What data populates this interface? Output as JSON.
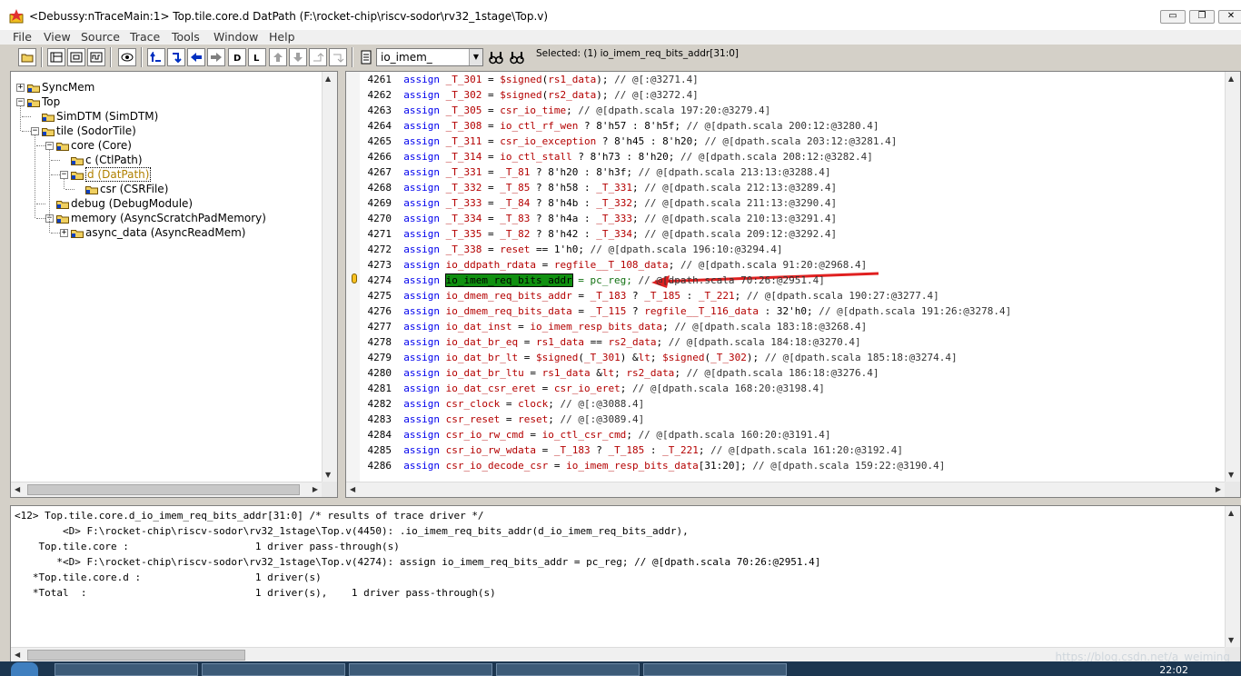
{
  "window": {
    "title": "<Debussy:nTraceMain:1> Top.tile.core.d DatPath (F:\\rocket-chip\\riscv-sodor\\rv32_1stage\\Top.v)",
    "controls": [
      "▭",
      "❐",
      "✕"
    ]
  },
  "menu": [
    "File",
    "View",
    "Source",
    "Trace",
    "Tools",
    "Window",
    "Help"
  ],
  "toolbar": {
    "signal_value": "io_imem_",
    "selected_text": "Selected: (1) io_imem_req_bits_addr[31:0]"
  },
  "hierarchy": [
    {
      "label": "SyncMem",
      "level": 0,
      "toggle": "+"
    },
    {
      "label": "Top",
      "level": 0,
      "toggle": "-"
    },
    {
      "label": "SimDTM (SimDTM)",
      "level": 1,
      "toggle": ""
    },
    {
      "label": "tile (SodorTile)",
      "level": 1,
      "toggle": "-"
    },
    {
      "label": "core (Core)",
      "level": 2,
      "toggle": "-"
    },
    {
      "label": "c (CtlPath)",
      "level": 3,
      "toggle": ""
    },
    {
      "label": "d (DatPath)",
      "level": 3,
      "toggle": "-",
      "selected": true
    },
    {
      "label": "csr (CSRFile)",
      "level": 4,
      "toggle": ""
    },
    {
      "label": "debug (DebugModule)",
      "level": 2,
      "toggle": ""
    },
    {
      "label": "memory (AsyncScratchPadMemory)",
      "level": 2,
      "toggle": "-"
    },
    {
      "label": "async_data (AsyncReadMem)",
      "level": 3,
      "toggle": "+"
    }
  ],
  "code_lines": [
    {
      "n": "4261",
      "text": "assign _T_301 = $signed(rs1_data); // @[:@3271.4]"
    },
    {
      "n": "4262",
      "text": "assign _T_302 = $signed(rs2_data); // @[:@3272.4]"
    },
    {
      "n": "4263",
      "text": "assign _T_305 = csr_io_time; // @[dpath.scala 197:20:@3279.4]"
    },
    {
      "n": "4264",
      "text": "assign _T_308 = io_ctl_rf_wen ? 8'h57 : 8'h5f; // @[dpath.scala 200:12:@3280.4]"
    },
    {
      "n": "4265",
      "text": "assign _T_311 = csr_io_exception ? 8'h45 : 8'h20; // @[dpath.scala 203:12:@3281.4]"
    },
    {
      "n": "4266",
      "text": "assign _T_314 = io_ctl_stall ? 8'h73 : 8'h20; // @[dpath.scala 208:12:@3282.4]"
    },
    {
      "n": "4267",
      "text": "assign _T_331 = _T_81 ? 8'h20 : 8'h3f; // @[dpath.scala 213:13:@3288.4]"
    },
    {
      "n": "4268",
      "text": "assign _T_332 = _T_85 ? 8'h58 : _T_331; // @[dpath.scala 212:13:@3289.4]"
    },
    {
      "n": "4269",
      "text": "assign _T_333 = _T_84 ? 8'h4b : _T_332; // @[dpath.scala 211:13:@3290.4]"
    },
    {
      "n": "4270",
      "text": "assign _T_334 = _T_83 ? 8'h4a : _T_333; // @[dpath.scala 210:13:@3291.4]"
    },
    {
      "n": "4271",
      "text": "assign _T_335 = _T_82 ? 8'h42 : _T_334; // @[dpath.scala 209:12:@3292.4]"
    },
    {
      "n": "4272",
      "text": "assign _T_338 = reset == 1'h0; // @[dpath.scala 196:10:@3294.4]"
    },
    {
      "n": "4273",
      "text": "assign io_ddpath_rdata = regfile__T_108_data; // @[dpath.scala 91:20:@2968.4]"
    },
    {
      "n": "4274",
      "text": "assign io_imem_req_bits_addr = pc_reg; // @[dpath.scala 70:26:@2951.4]",
      "hl": "io_imem_req_bits_addr"
    },
    {
      "n": "4275",
      "text": "assign io_dmem_req_bits_addr = _T_183 ? _T_185 : _T_221; // @[dpath.scala 190:27:@3277.4]"
    },
    {
      "n": "4276",
      "text": "assign io_dmem_req_bits_data = _T_115 ? regfile__T_116_data : 32'h0; // @[dpath.scala 191:26:@3278.4]"
    },
    {
      "n": "4277",
      "text": "assign io_dat_inst = io_imem_resp_bits_data; // @[dpath.scala 183:18:@3268.4]"
    },
    {
      "n": "4278",
      "text": "assign io_dat_br_eq = rs1_data == rs2_data; // @[dpath.scala 184:18:@3270.4]"
    },
    {
      "n": "4279",
      "text": "assign io_dat_br_lt = $signed(_T_301) < $signed(_T_302); // @[dpath.scala 185:18:@3274.4]"
    },
    {
      "n": "4280",
      "text": "assign io_dat_br_ltu = rs1_data < rs2_data; // @[dpath.scala 186:18:@3276.4]"
    },
    {
      "n": "4281",
      "text": "assign io_dat_csr_eret = csr_io_eret; // @[dpath.scala 168:20:@3198.4]"
    },
    {
      "n": "4282",
      "text": "assign csr_clock = clock; // @[:@3088.4]"
    },
    {
      "n": "4283",
      "text": "assign csr_reset = reset; // @[:@3089.4]"
    },
    {
      "n": "4284",
      "text": "assign csr_io_rw_cmd = io_ctl_csr_cmd; // @[dpath.scala 160:20:@3191.4]"
    },
    {
      "n": "4285",
      "text": "assign csr_io_rw_wdata = _T_183 ? _T_185 : _T_221; // @[dpath.scala 161:20:@3192.4]"
    },
    {
      "n": "4286",
      "text": "assign csr_io_decode_csr = io_imem_resp_bits_data[31:20]; // @[dpath.scala 159:22:@3190.4]"
    }
  ],
  "messages": [
    "<12> Top.tile.core.d_io_imem_req_bits_addr[31:0] /* results of trace driver */",
    "        <D> F:\\rocket-chip\\riscv-sodor\\rv32_1stage\\Top.v(4450): .io_imem_req_bits_addr(d_io_imem_req_bits_addr),",
    "    Top.tile.core :                     1 driver pass-through(s)",
    "       *<D> F:\\rocket-chip\\riscv-sodor\\rv32_1stage\\Top.v(4274): assign io_imem_req_bits_addr = pc_reg; // @[dpath.scala 70:26:@2951.4]",
    "   *Top.tile.core.d :                   1 driver(s)",
    "   *Total  :                            1 driver(s),    1 driver pass-through(s)"
  ],
  "taskbar": {
    "clock": "22:02"
  },
  "watermark": "https://blog.csdn.net/a_weiming",
  "colors": {
    "keyword": "#0000ee",
    "identifier": "#b40000",
    "highlight": "#109010",
    "annotation_arrow": "#e02020"
  }
}
